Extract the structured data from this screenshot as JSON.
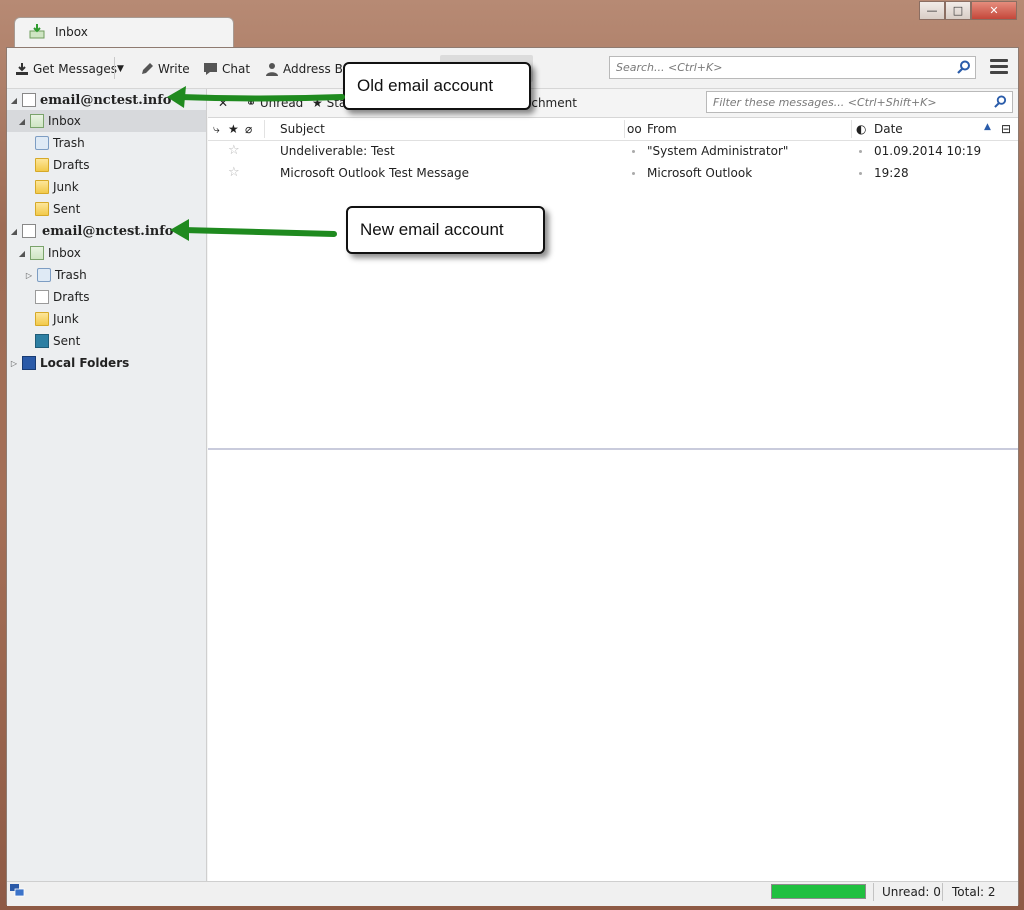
{
  "window": {
    "tab_title": "Inbox",
    "controls": {
      "minimize": "—",
      "maximize": "□",
      "close": "✕"
    }
  },
  "toolbar": {
    "get_messages": "Get Messages",
    "write": "Write",
    "chat": "Chat",
    "address_book": "Address Bo",
    "search_placeholder": "Search... <Ctrl+K>"
  },
  "sidebar": {
    "old_account": {
      "label": "email@nctest.info",
      "folders": [
        "Inbox",
        "Trash",
        "Drafts",
        "Junk",
        "Sent"
      ]
    },
    "new_account": {
      "label": "email@nctest.info",
      "folders": [
        "Inbox",
        "Trash",
        "Drafts",
        "Junk",
        "Sent"
      ]
    },
    "local_folders": "Local Folders"
  },
  "filter": {
    "unread": "Unread",
    "starred": "Sta",
    "attachment": "achment",
    "placeholder": "Filter these messages... <Ctrl+Shift+K>"
  },
  "columns": {
    "subject": "Subject",
    "from": "From",
    "date": "Date"
  },
  "messages": [
    {
      "subject": "Undeliverable: Test",
      "from": "\"System Administrator\"",
      "date": "01.09.2014 10:19"
    },
    {
      "subject": "Microsoft Outlook Test Message",
      "from": "Microsoft Outlook",
      "date": "19:28"
    }
  ],
  "status": {
    "unread": "Unread: 0",
    "total": "Total: 2",
    "progress": 1.0
  },
  "callouts": {
    "old": "Old email account",
    "new": "New email account"
  },
  "colors": {
    "arrow": "#1f8a1f",
    "progress": "#20c040",
    "accent": "#b78a74"
  }
}
